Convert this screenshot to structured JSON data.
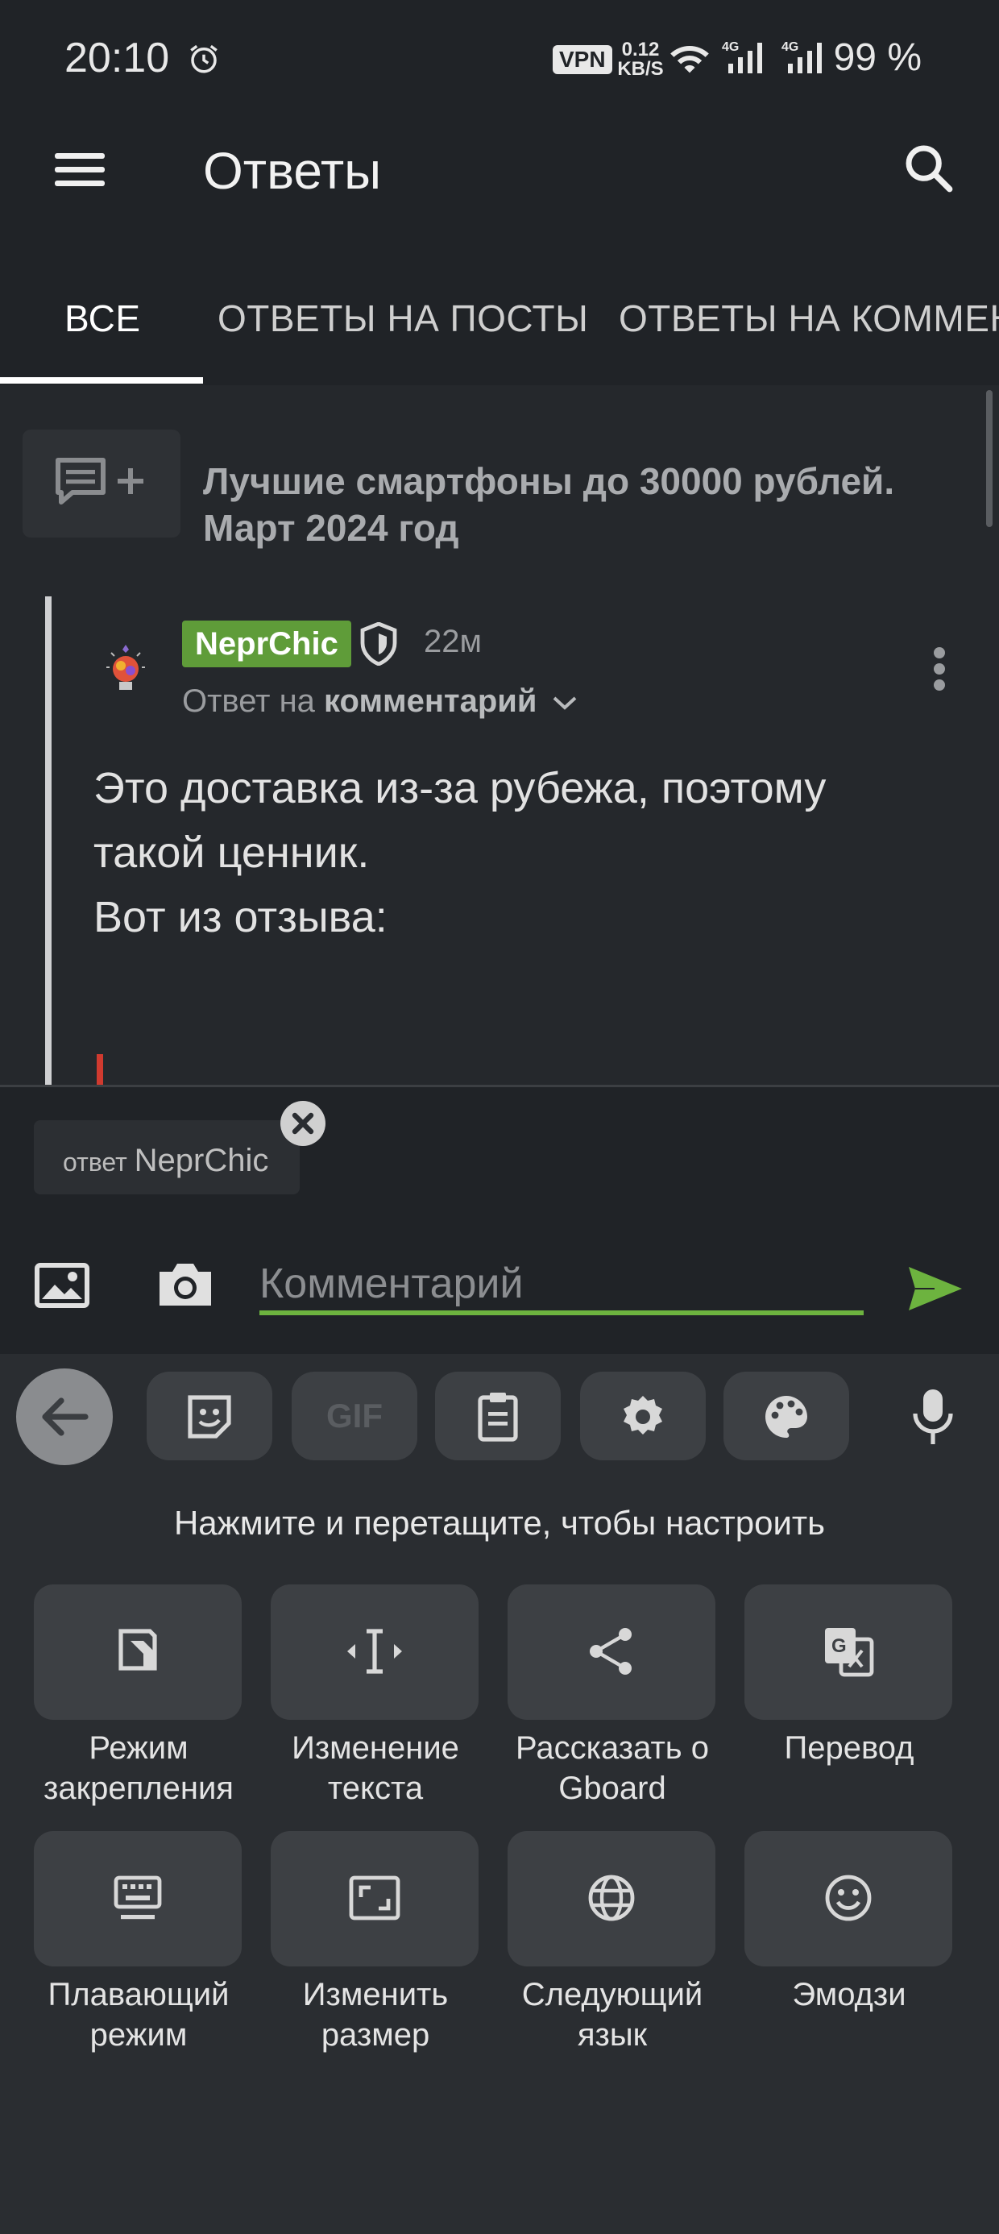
{
  "status_bar": {
    "time": "20:10",
    "vpn": "VPN",
    "speed_top": "0.12",
    "speed_bottom": "KB/S",
    "net1": "4G",
    "net2": "4G",
    "battery": "99 %"
  },
  "header": {
    "title": "Ответы"
  },
  "tabs": [
    {
      "label": "ВСЕ",
      "active": true
    },
    {
      "label": "ОТВЕТЫ НА ПОСТЫ",
      "active": false
    },
    {
      "label": "ОТВЕТЫ НА КОММЕНТАРИИ",
      "active": false
    }
  ],
  "post": {
    "title": "Лучшие смартфоны до 30000 рублей. Март 2024 год"
  },
  "comment": {
    "username": "NeprChic",
    "time": "22м",
    "reply_prefix": "Ответ на",
    "reply_target": "комментарий",
    "body_line1": "Это доставка из-за рубежа, поэтому",
    "body_line2": "такой ценник.",
    "body_line3": "Вот из отзыва:"
  },
  "compose": {
    "reply_label": "ответ",
    "reply_user": "NeprChic",
    "placeholder": "Комментарий"
  },
  "keyboard": {
    "gif_label": "GIF",
    "hint": "Нажмите и перетащите, чтобы настроить",
    "tiles": [
      {
        "line1": "Режим",
        "line2": "закрепления",
        "icon": "pin-mode-icon"
      },
      {
        "line1": "Изменение",
        "line2": "текста",
        "icon": "text-edit-icon"
      },
      {
        "line1": "Рассказать о",
        "line2": "Gboard",
        "icon": "share-icon"
      },
      {
        "line1": "Перевод",
        "line2": "",
        "icon": "translate-icon"
      },
      {
        "line1": "Плавающий",
        "line2": "режим",
        "icon": "floating-keyboard-icon"
      },
      {
        "line1": "Изменить",
        "line2": "размер",
        "icon": "resize-icon"
      },
      {
        "line1": "Следующий",
        "line2": "язык",
        "icon": "globe-icon"
      },
      {
        "line1": "Эмодзи",
        "line2": "",
        "icon": "emoji-icon"
      }
    ]
  },
  "colors": {
    "accent_green": "#6db33f",
    "username_badge": "#5f9c39",
    "background": "#202327"
  }
}
